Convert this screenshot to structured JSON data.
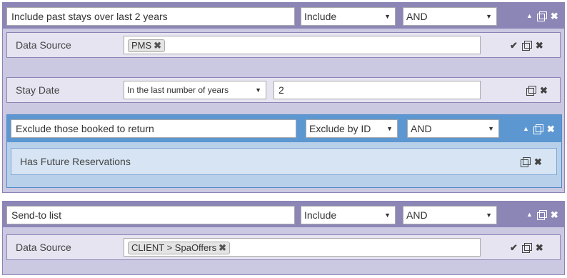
{
  "group1": {
    "name_value": "Include past stays over last 2 years",
    "mode": "Include",
    "operator": "AND",
    "rows": [
      {
        "label": "Data Source",
        "tags": [
          "PMS"
        ]
      },
      {
        "label": "Stay Date",
        "select_value": "In the last number of years",
        "input_value": "2"
      }
    ],
    "subgroup": {
      "name_value": "Exclude those booked to return",
      "mode": "Exclude by ID",
      "operator": "AND",
      "row_label": "Has Future Reservations"
    }
  },
  "group2": {
    "name_value": "Send-to list",
    "mode": "Include",
    "operator": "AND",
    "rows": [
      {
        "label": "Data Source",
        "tags": [
          "CLIENT > SpaOffers"
        ]
      }
    ]
  },
  "icons": {
    "caret": "▼",
    "up": "▲",
    "close": "✖",
    "check": "✔",
    "tag_remove": "✖"
  },
  "colors": {
    "group_header": "#8c86b6",
    "group_body": "#cbc8e2",
    "row_bg": "#e6e4f1",
    "subgroup_header": "#5d97d1",
    "subgroup_body": "#b9d0ea",
    "subrow_bg": "#d6e4f3"
  }
}
